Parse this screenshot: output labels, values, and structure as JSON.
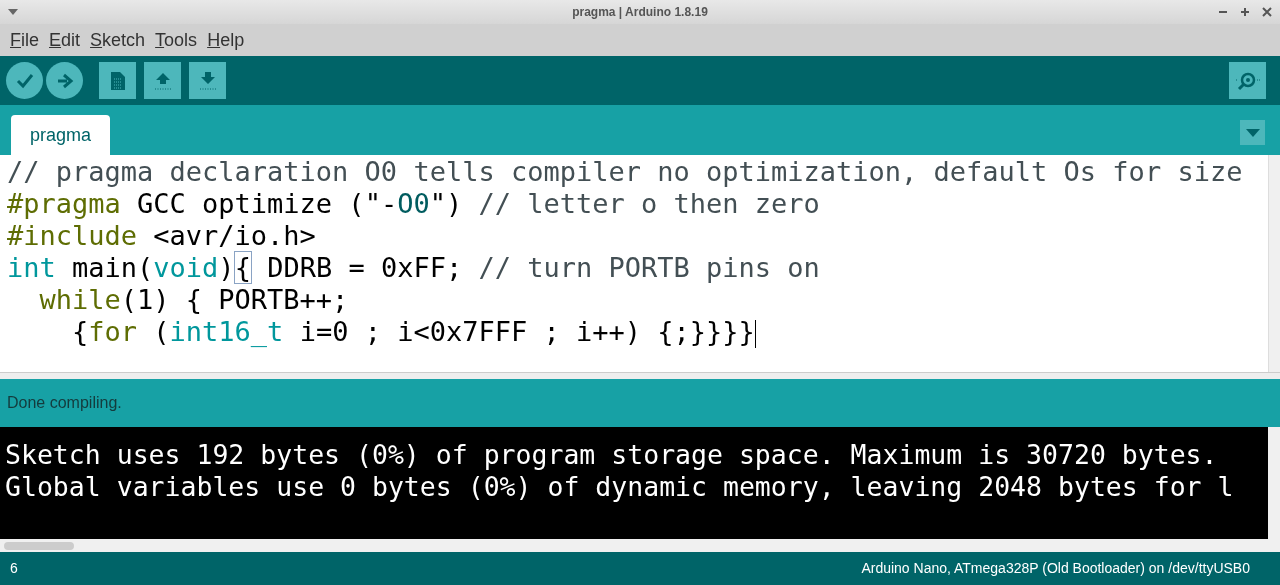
{
  "window": {
    "title": "pragma | Arduino 1.8.19"
  },
  "menu": [
    {
      "label": "File"
    },
    {
      "label": "Edit"
    },
    {
      "label": "Sketch"
    },
    {
      "label": "Tools"
    },
    {
      "label": "Help"
    }
  ],
  "tabs": [
    {
      "label": "pragma",
      "selected": true
    }
  ],
  "editor": {
    "lines": [
      [
        {
          "kind": "comment",
          "text": "// pragma declaration O0 tells compiler no optimization, default Os for size"
        }
      ],
      [
        {
          "kind": "keyword",
          "text": "#pragma"
        },
        {
          "kind": "plain",
          "text": " GCC optimize (\"-"
        },
        {
          "kind": "string",
          "text": "O0"
        },
        {
          "kind": "plain",
          "text": "\") "
        },
        {
          "kind": "comment",
          "text": "// letter o then zero"
        }
      ],
      [
        {
          "kind": "keyword",
          "text": "#include"
        },
        {
          "kind": "plain",
          "text": " <avr/io.h>"
        }
      ],
      [
        {
          "kind": "type",
          "text": "int"
        },
        {
          "kind": "plain",
          "text": " main("
        },
        {
          "kind": "type",
          "text": "void"
        },
        {
          "kind": "plain",
          "text": ")"
        },
        {
          "kind": "bracket",
          "text": "{"
        },
        {
          "kind": "plain",
          "text": " DDRB = 0xFF; "
        },
        {
          "kind": "comment",
          "text": "// turn PORTB pins on"
        }
      ],
      [
        {
          "kind": "keyword",
          "text": "  while"
        },
        {
          "kind": "plain",
          "text": "(1) { PORTB++;"
        }
      ],
      [
        {
          "kind": "plain",
          "text": "    {"
        },
        {
          "kind": "keyword",
          "text": "for"
        },
        {
          "kind": "plain",
          "text": " ("
        },
        {
          "kind": "type",
          "text": "int16_t"
        },
        {
          "kind": "plain",
          "text": " i=0 ; i<0x7FFF ; i++) {;}}}}"
        }
      ]
    ]
  },
  "message": "Done compiling.",
  "console": [
    "Sketch uses 192 bytes (0%) of program storage space. Maximum is 30720 bytes.",
    "Global variables use 0 bytes (0%) of dynamic memory, leaving 2048 bytes for l"
  ],
  "status_bar": {
    "line": "6",
    "board": "Arduino Nano, ATmega328P (Old Bootloader) on /dev/ttyUSB0"
  }
}
